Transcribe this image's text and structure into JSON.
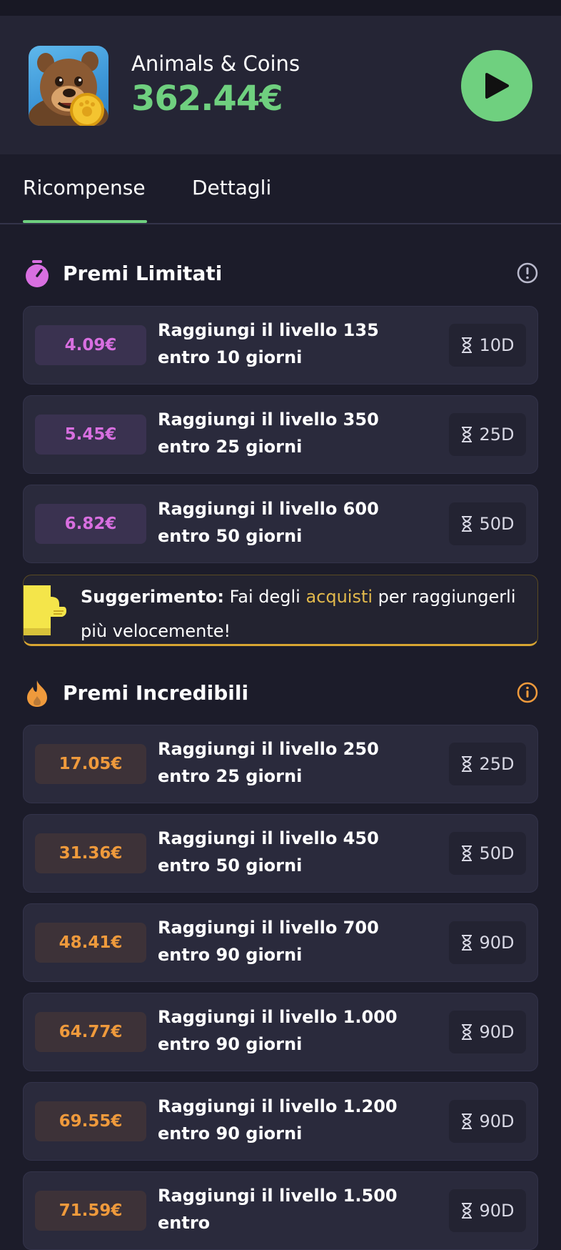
{
  "app": {
    "name": "Animals & Coins",
    "amount": "362.44€"
  },
  "tabs": [
    {
      "label": "Ricompense",
      "active": true
    },
    {
      "label": "Dettagli",
      "active": false
    }
  ],
  "colors": {
    "accent_green": "#6fd07f",
    "limited_purple": "#d86fe0",
    "incredible_orange": "#ef9a3c",
    "tip_gold": "#e2b94c"
  },
  "limited": {
    "title": "Premi Limitati",
    "icon": "stopwatch-icon",
    "items": [
      {
        "reward": "4.09€",
        "desc": "Raggiungi il livello 135 entro 10 giorni",
        "days": "10D"
      },
      {
        "reward": "5.45€",
        "desc": "Raggiungi il livello 350 entro 25 giorni",
        "days": "25D"
      },
      {
        "reward": "6.82€",
        "desc": "Raggiungi il livello 600 entro 50 giorni",
        "days": "50D"
      }
    ]
  },
  "tip": {
    "label": "Suggerimento:",
    "text_before": " Fai degli ",
    "link": "acquisti",
    "text_after": " per raggiungerli più velocemente!"
  },
  "incredible": {
    "title": "Premi Incredibili",
    "icon": "flame-icon",
    "items": [
      {
        "reward": "17.05€",
        "desc": "Raggiungi il livello 250 entro 25 giorni",
        "days": "25D"
      },
      {
        "reward": "31.36€",
        "desc": "Raggiungi il livello 450 entro 50 giorni",
        "days": "50D"
      },
      {
        "reward": "48.41€",
        "desc": "Raggiungi il livello 700 entro 90 giorni",
        "days": "90D"
      },
      {
        "reward": "64.77€",
        "desc": "Raggiungi il livello 1.000 entro 90 giorni",
        "days": "90D"
      },
      {
        "reward": "69.55€",
        "desc": "Raggiungi il livello 1.200 entro 90 giorni",
        "days": "90D"
      },
      {
        "reward": "71.59€",
        "desc": "Raggiungi il livello 1.500 entro",
        "days": "90D"
      }
    ]
  }
}
